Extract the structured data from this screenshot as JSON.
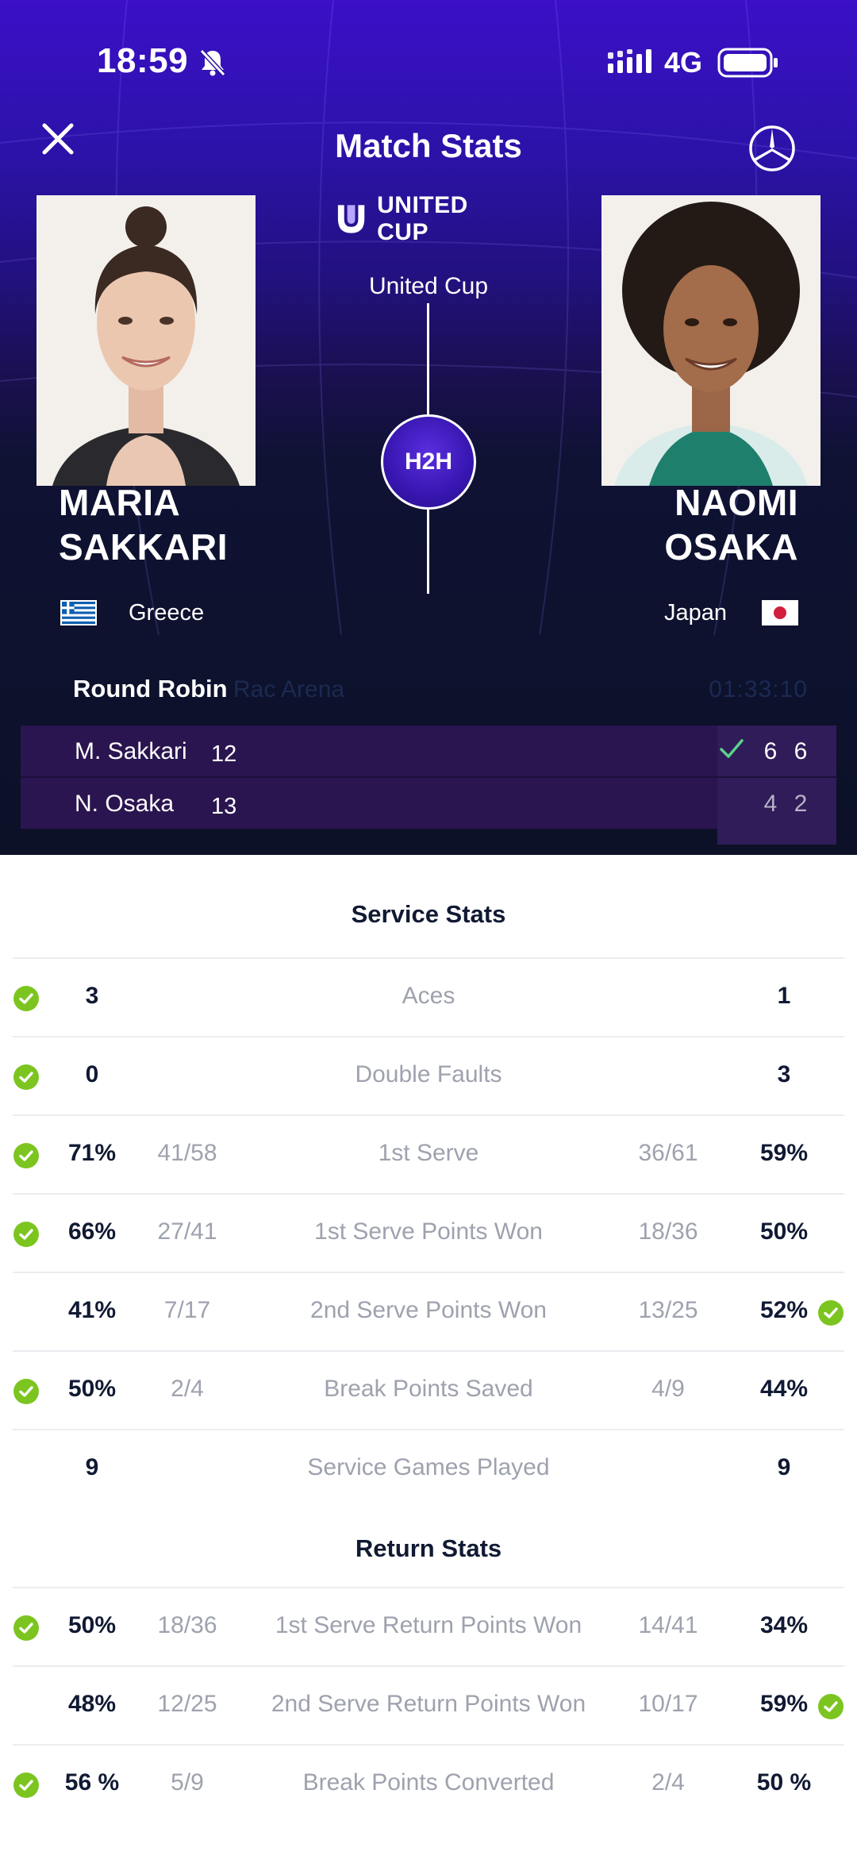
{
  "status_bar": {
    "time": "18:59",
    "network": "4G"
  },
  "header": {
    "title": "Match Stats",
    "logo_text": "UNITED CUP",
    "event": "United Cup",
    "h2h_label": "H2H"
  },
  "players": {
    "left": {
      "first": "MARIA",
      "last": "SAKKARI",
      "country": "Greece"
    },
    "right": {
      "first": "NAOMI",
      "last": "OSAKA",
      "country": "Japan"
    }
  },
  "match": {
    "round": "Round Robin",
    "venue": "Rac Arena",
    "duration": "01:33:10"
  },
  "scoreboard": [
    {
      "name": "M. Sakkari",
      "seed": "12",
      "sets": [
        "6",
        "6"
      ],
      "winner": true
    },
    {
      "name": "N. Osaka",
      "seed": "13",
      "sets": [
        "4",
        "2"
      ],
      "winner": false
    }
  ],
  "service_stats": {
    "title": "Service Stats",
    "rows": [
      {
        "label": "Aces",
        "left": "3",
        "left_frac": "",
        "right": "1",
        "right_frac": "",
        "winner": "left"
      },
      {
        "label": "Double Faults",
        "left": "0",
        "left_frac": "",
        "right": "3",
        "right_frac": "",
        "winner": "left"
      },
      {
        "label": "1st Serve",
        "left": "71%",
        "left_frac": "41/58",
        "right": "59%",
        "right_frac": "36/61",
        "winner": "left"
      },
      {
        "label": "1st Serve Points Won",
        "left": "66%",
        "left_frac": "27/41",
        "right": "50%",
        "right_frac": "18/36",
        "winner": "left"
      },
      {
        "label": "2nd Serve Points Won",
        "left": "41%",
        "left_frac": "7/17",
        "right": "52%",
        "right_frac": "13/25",
        "winner": "right"
      },
      {
        "label": "Break Points Saved",
        "left": "50%",
        "left_frac": "2/4",
        "right": "44%",
        "right_frac": "4/9",
        "winner": "left"
      },
      {
        "label": "Service Games Played",
        "left": "9",
        "left_frac": "",
        "right": "9",
        "right_frac": "",
        "winner": "none"
      }
    ]
  },
  "return_stats": {
    "title": "Return Stats",
    "rows": [
      {
        "label": "1st Serve Return Points Won",
        "left": "50%",
        "left_frac": "18/36",
        "right": "34%",
        "right_frac": "14/41",
        "winner": "left"
      },
      {
        "label": "2nd Serve Return Points Won",
        "left": "48%",
        "left_frac": "12/25",
        "right": "59%",
        "right_frac": "10/17",
        "winner": "right"
      },
      {
        "label": "Break Points Converted",
        "left": "56 %",
        "left_frac": "5/9",
        "right": "50 %",
        "right_frac": "2/4",
        "winner": "left"
      }
    ]
  },
  "colors": {
    "accent_purple": "#3b10c8",
    "dark_navy": "#0c1128",
    "win_green": "#7cc520",
    "text_dark": "#111a33",
    "text_muted": "#9ea2ae"
  },
  "icons": [
    "close-icon",
    "mercedes-star-icon",
    "bell-muted-icon",
    "signal-icon",
    "battery-icon",
    "check-circle-icon",
    "check-icon",
    "flag-greece-icon",
    "flag-japan-icon"
  ]
}
